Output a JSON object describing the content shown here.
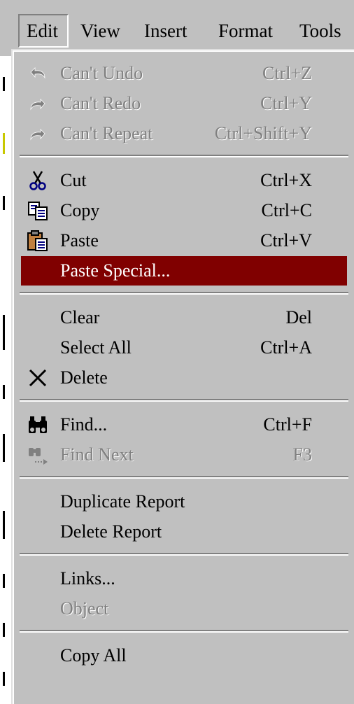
{
  "menubar": {
    "items": [
      {
        "label": "Edit"
      },
      {
        "label": "View"
      },
      {
        "label": "Insert"
      },
      {
        "label": "Format"
      },
      {
        "label": "Tools"
      }
    ]
  },
  "edit_menu": {
    "groups": [
      [
        {
          "label": "Can't Undo",
          "shortcut": "Ctrl+Z",
          "icon": "undo-icon",
          "enabled": false
        },
        {
          "label": "Can't Redo",
          "shortcut": "Ctrl+Y",
          "icon": "redo-icon",
          "enabled": false
        },
        {
          "label": "Can't Repeat",
          "shortcut": "Ctrl+Shift+Y",
          "icon": "repeat-icon",
          "enabled": false
        }
      ],
      [
        {
          "label": "Cut",
          "shortcut": "Ctrl+X",
          "icon": "scissors-icon",
          "enabled": true
        },
        {
          "label": "Copy",
          "shortcut": "Ctrl+C",
          "icon": "copy-icon",
          "enabled": true
        },
        {
          "label": "Paste",
          "shortcut": "Ctrl+V",
          "icon": "paste-icon",
          "enabled": true
        },
        {
          "label": "Paste Special...",
          "shortcut": "",
          "icon": "",
          "enabled": true,
          "highlighted": true
        }
      ],
      [
        {
          "label": "Clear",
          "shortcut": "Del",
          "icon": "",
          "enabled": true
        },
        {
          "label": "Select All",
          "shortcut": "Ctrl+A",
          "icon": "",
          "enabled": true
        },
        {
          "label": "Delete",
          "shortcut": "",
          "icon": "delete-x-icon",
          "enabled": true
        }
      ],
      [
        {
          "label": "Find...",
          "shortcut": "Ctrl+F",
          "icon": "binoculars-icon",
          "enabled": true
        },
        {
          "label": "Find Next",
          "shortcut": "F3",
          "icon": "find-next-icon",
          "enabled": false
        }
      ],
      [
        {
          "label": "Duplicate Report",
          "shortcut": "",
          "icon": "",
          "enabled": true
        },
        {
          "label": "Delete Report",
          "shortcut": "",
          "icon": "",
          "enabled": true
        }
      ],
      [
        {
          "label": "Links...",
          "shortcut": "",
          "icon": "",
          "enabled": true
        },
        {
          "label": "Object",
          "shortcut": "",
          "icon": "",
          "enabled": false
        }
      ],
      [
        {
          "label": "Copy All",
          "shortcut": "",
          "icon": "",
          "enabled": true
        }
      ]
    ]
  },
  "colors": {
    "menu_face": "#c0c0c0",
    "highlight": "#800000",
    "disabled_text": "#808080"
  }
}
